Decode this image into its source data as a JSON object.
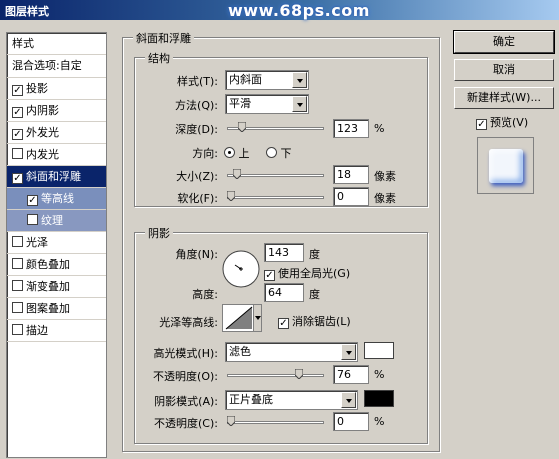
{
  "window": {
    "title": "图层样式",
    "watermark": "www.68ps.com"
  },
  "stylelist": {
    "header": "样式",
    "blend": "混合选项:自定",
    "items": [
      {
        "label": "投影",
        "checked": true
      },
      {
        "label": "内阴影",
        "checked": true
      },
      {
        "label": "外发光",
        "checked": true
      },
      {
        "label": "内发光",
        "checked": false
      },
      {
        "label": "斜面和浮雕",
        "checked": true
      },
      {
        "label": "等高线",
        "checked": true
      },
      {
        "label": "纹理",
        "checked": false
      },
      {
        "label": "光泽",
        "checked": false
      },
      {
        "label": "颜色叠加",
        "checked": false
      },
      {
        "label": "渐变叠加",
        "checked": false
      },
      {
        "label": "图案叠加",
        "checked": false
      },
      {
        "label": "描边",
        "checked": false
      }
    ]
  },
  "bevel": {
    "group_title": "斜面和浮雕",
    "structure_title": "结构",
    "style_label": "样式(T):",
    "style_value": "内斜面",
    "technique_label": "方法(Q):",
    "technique_value": "平滑",
    "depth_label": "深度(D):",
    "depth_value": "123",
    "depth_unit": "%",
    "depth_pct": 0.12,
    "direction_label": "方向:",
    "dir_up": "上",
    "dir_down": "下",
    "size_label": "大小(Z):",
    "size_value": "18",
    "size_unit": "像素",
    "size_pct": 0.07,
    "soften_label": "软化(F):",
    "soften_value": "0",
    "soften_unit": "像素",
    "soften_pct": 0.0
  },
  "shading": {
    "title": "阴影",
    "angle_label": "角度(N):",
    "angle_value": "143",
    "angle_unit": "度",
    "global_light": "使用全局光(G)",
    "altitude_label": "高度:",
    "altitude_value": "64",
    "altitude_unit": "度",
    "gloss_label": "光泽等高线:",
    "antialias": "消除锯齿(L)",
    "highlight_mode_label": "高光模式(H):",
    "highlight_mode": "滤色",
    "highlight_color": "#ffffff",
    "opacity1_label": "不透明度(O):",
    "opacity1_value": "76",
    "opacity1_pct": 0.76,
    "opacity_unit": "%",
    "shadow_mode_label": "阴影模式(A):",
    "shadow_mode": "正片叠底",
    "shadow_color": "#000000",
    "opacity2_label": "不透明度(C):",
    "opacity2_value": "0",
    "opacity2_pct": 0.0
  },
  "buttons": {
    "ok": "确定",
    "cancel": "取消",
    "new_style": "新建样式(W)...",
    "preview": "预览(V)"
  }
}
